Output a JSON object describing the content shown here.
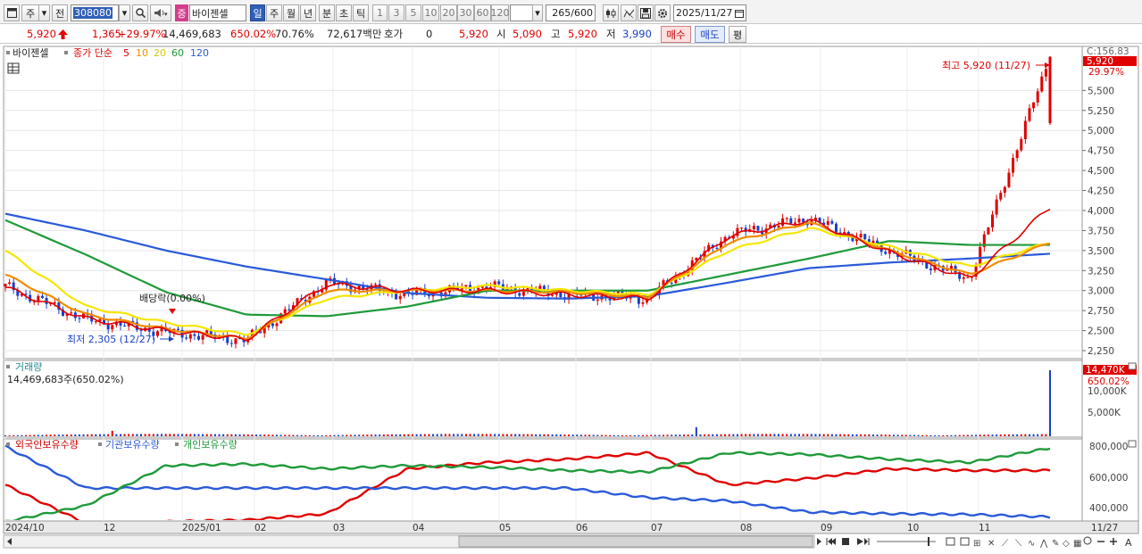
{
  "toolbar": {
    "menu_icon": "window-menu-icon",
    "market": "주",
    "prev_label": "전",
    "code": "308080",
    "stock_tag": "증",
    "stock_name": "바이젠셀",
    "periods": [
      "일",
      "주",
      "월",
      "년",
      "분",
      "초",
      "틱"
    ],
    "active_period": "일",
    "minute_steps": [
      "1",
      "3",
      "5",
      "10",
      "20",
      "30",
      "60",
      "120"
    ],
    "count": "265",
    "count_total": "/600",
    "date": "2025/11/27"
  },
  "quote": {
    "price": "5,920",
    "change": "1,365",
    "change_pct": "+29.97%",
    "volume": "14,469,683",
    "volume_pct": "650.02%",
    "rate": "70.76%",
    "amount": "72,617백만",
    "bid_label": "호가",
    "bid_value": "0",
    "bid_price": "5,920",
    "open_label": "시",
    "open": "5,090",
    "high_label": "고",
    "high": "5,920",
    "low_label": "저",
    "low": "3,990",
    "buy_label": "매수",
    "sell_label": "매도",
    "eval_label": "평"
  },
  "legend": {
    "name": "바이젠셀",
    "close_label": "종가 단순",
    "ma5": "5",
    "ma10": "10",
    "ma20": "20",
    "ma60": "60",
    "ma120": "120",
    "ma_colors": {
      "ma5": "#e00000",
      "ma10": "#f08c00",
      "ma20": "#f5e600",
      "ma60": "#1f9a3a",
      "ma120": "#2a5ad8"
    }
  },
  "annotations": {
    "high": "최고 5,920 (11/27)",
    "low": "최저 2,305 (12/27)",
    "dividend": "배당락(0.00%)"
  },
  "price_axis": {
    "top": "C:156.83",
    "current": "5,920",
    "current_pct": "29.97%",
    "ticks": [
      "5,500",
      "5,250",
      "5,000",
      "4,750",
      "4,500",
      "4,250",
      "4,000",
      "3,750",
      "3,500",
      "3,250",
      "3,000",
      "2,750",
      "2,500",
      "2,250"
    ]
  },
  "volume_panel": {
    "title": "거래량",
    "detail": "14,469,683주(650.02%)",
    "current": "14,470K",
    "current_pct": "650.02%",
    "ticks": [
      "10,000K",
      "5,000K"
    ]
  },
  "holding_panel": {
    "foreign": "외국인보유수량",
    "inst": "기관보유수량",
    "indiv": "개인보유수량",
    "ticks": [
      "800,000",
      "600,000",
      "400,000"
    ]
  },
  "x_axis": {
    "labels": [
      "2024/10",
      "12",
      "2025/01",
      "02",
      "03",
      "04",
      "05",
      "06",
      "07",
      "08",
      "09",
      "10",
      "11"
    ],
    "right_label": "11/27"
  },
  "chart_data": [
    {
      "type": "candlestick",
      "title": "바이젠셀",
      "x": [
        "2024/10",
        "12",
        "2025/01",
        "02",
        "03",
        "04",
        "05",
        "06",
        "07",
        "08",
        "09",
        "10",
        "11",
        "11/27"
      ],
      "close": [
        3050,
        2640,
        2480,
        2380,
        3100,
        2950,
        3050,
        2950,
        2900,
        3700,
        3900,
        3500,
        3150,
        5920
      ],
      "ma5": [
        3040,
        2650,
        2500,
        2390,
        3080,
        3000,
        3000,
        2950,
        2900,
        3680,
        3880,
        3480,
        3150,
        4040
      ],
      "ma10": [
        3200,
        2700,
        2520,
        2400,
        3000,
        3000,
        3000,
        2980,
        2920,
        3600,
        3850,
        3500,
        3200,
        3600
      ],
      "ma20": [
        3500,
        2800,
        2600,
        2450,
        2900,
        3000,
        3060,
        3000,
        2950,
        3500,
        3780,
        3550,
        3300,
        3600
      ],
      "ma60": [
        3880,
        3450,
        2980,
        2700,
        2680,
        2800,
        3000,
        3000,
        3000,
        3200,
        3400,
        3620,
        3570,
        3570
      ],
      "ma120": [
        3960,
        3750,
        3500,
        3300,
        3140,
        2970,
        2910,
        2900,
        2930,
        3100,
        3280,
        3350,
        3400,
        3460
      ],
      "ylim": [
        2150,
        6050
      ],
      "high_marker": 5920,
      "low_marker": 2305
    },
    {
      "type": "bar",
      "title": "거래량",
      "ylim": [
        0,
        14470000
      ],
      "current": 14469683
    },
    {
      "type": "line",
      "series": [
        {
          "name": "외국인보유수량",
          "values": [
            560000,
            320000,
            330000,
            340000,
            380000,
            660000,
            700000,
            720000,
            760000,
            560000,
            600000,
            660000,
            650000,
            650000
          ]
        },
        {
          "name": "기관보유수량",
          "values": [
            800000,
            540000,
            540000,
            540000,
            540000,
            540000,
            540000,
            540000,
            480000,
            460000,
            390000,
            380000,
            375000,
            360000
          ]
        },
        {
          "name": "개인보유수량",
          "values": [
            330000,
            430000,
            680000,
            690000,
            660000,
            680000,
            670000,
            650000,
            640000,
            760000,
            750000,
            720000,
            700000,
            790000
          ]
        }
      ],
      "ylim": [
        340000,
        830000
      ]
    }
  ]
}
